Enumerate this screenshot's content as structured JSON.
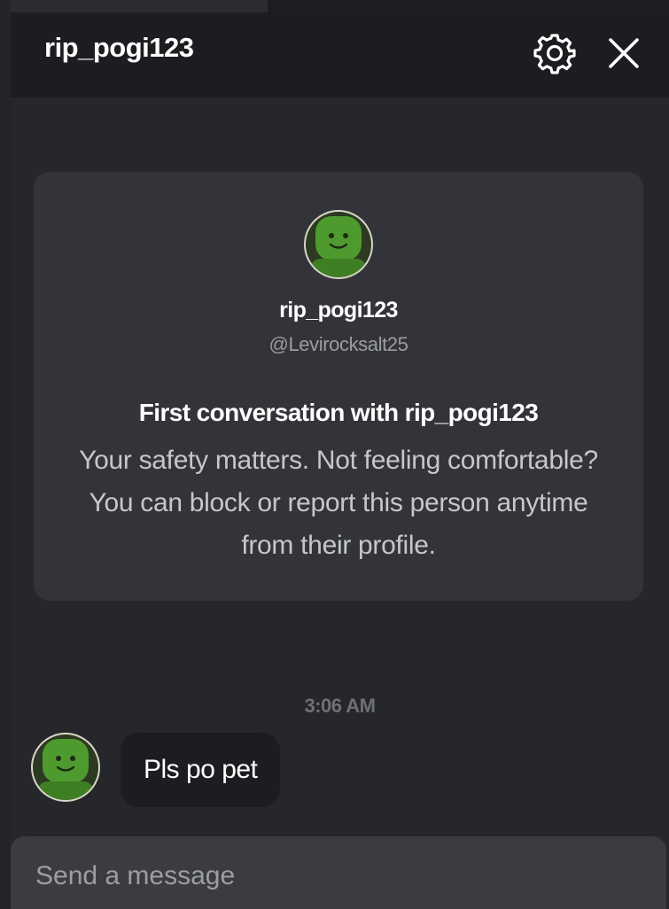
{
  "header": {
    "title": "rip_pogi123",
    "settings_icon": "gear-icon",
    "close_icon": "close-icon"
  },
  "intro": {
    "display_name": "rip_pogi123",
    "username": "@Levirocksalt25",
    "heading": "First conversation with rip_pogi123",
    "body": "Your safety matters. Not feeling comfortable? You can block or report this person anytime from their profile."
  },
  "messages": [
    {
      "timestamp": "3:06 AM",
      "text": "Pls po pet"
    }
  ],
  "composer": {
    "placeholder": "Send a message"
  },
  "colors": {
    "header_bg": "#1c1d20",
    "panel_bg": "#26272b",
    "card_bg": "#323439",
    "bubble_bg": "#1c1d20",
    "avatar_green": "#4e9a2e"
  }
}
